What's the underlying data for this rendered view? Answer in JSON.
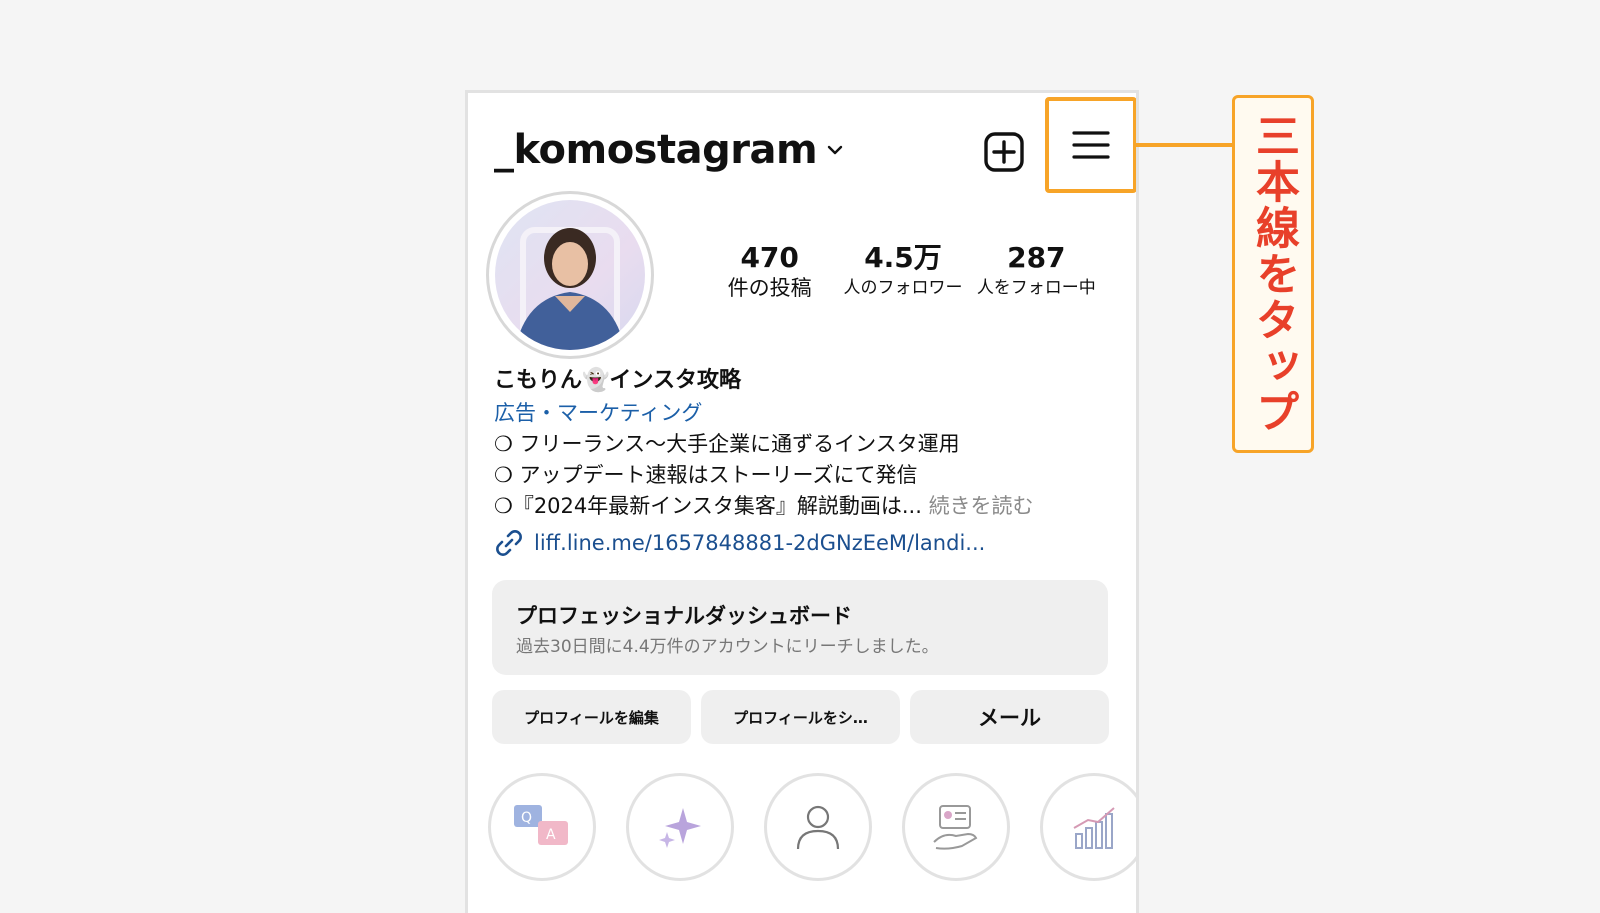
{
  "profile": {
    "username": "_komostagram",
    "name": "こもりん👻インスタ攻略",
    "category": "広告・マーケティング",
    "bio_lines": [
      "❍ フリーランス〜大手企業に通ずるインスタ運用",
      "❍ アップデート速報はストーリーズにて発信",
      "❍『2024年最新インスタ集客』解説動画は..."
    ],
    "read_more": "続きを読む",
    "link": "liff.line.me/1657848881-2dGNzEeM/landi..."
  },
  "stats": [
    {
      "value": "470",
      "label": "件の投稿"
    },
    {
      "value": "4.5万",
      "label": "人のフォロワー"
    },
    {
      "value": "287",
      "label": "人をフォロー中"
    }
  ],
  "dashboard": {
    "title": "プロフェッショナルダッシュボード",
    "subtitle": "過去30日間に4.4万件のアカウントにリーチしました。"
  },
  "buttons": {
    "edit": "プロフィールを編集",
    "share": "プロフィールをシ…",
    "mail": "メール"
  },
  "callout": {
    "text": "三本線をタップ"
  },
  "colors": {
    "accent_orange": "#f7a428",
    "callout_text": "#e8402a",
    "link_blue": "#1b4f8f"
  }
}
